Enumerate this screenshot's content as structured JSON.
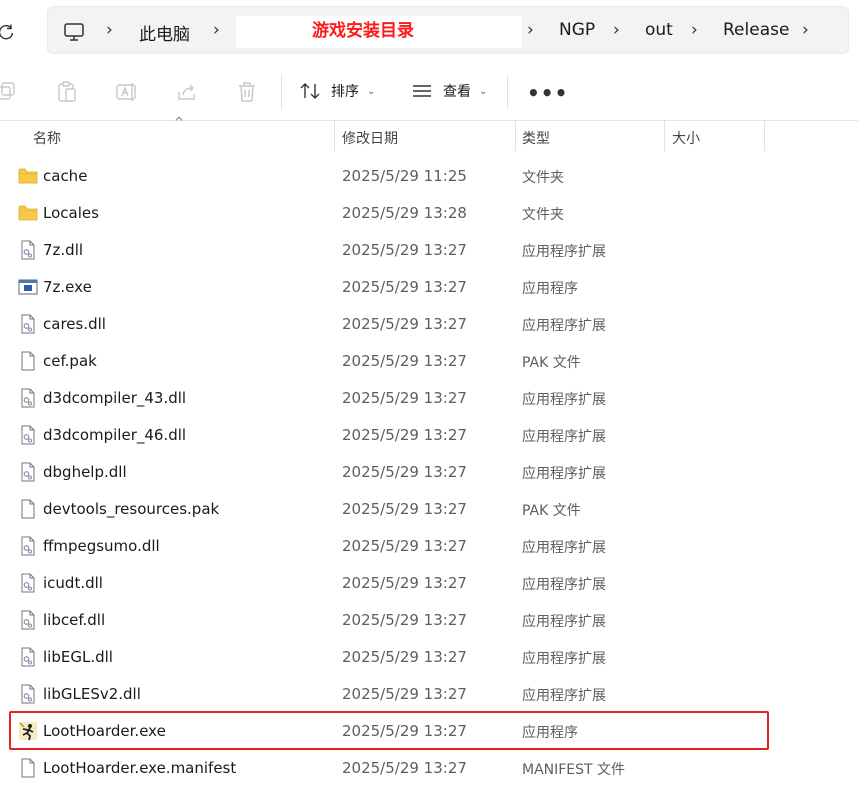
{
  "address_bar": {
    "segments": [
      "此电脑",
      "NGP",
      "out",
      "Release"
    ],
    "annotation": "游戏安装目录"
  },
  "toolbar": {
    "sort_label": "排序",
    "view_label": "查看",
    "more_label": "•••"
  },
  "columns": {
    "name": "名称",
    "modified": "修改日期",
    "type": "类型",
    "size": "大小"
  },
  "files": [
    {
      "name": "cache",
      "date": "2025/5/29 11:25",
      "type": "文件夹",
      "icon": "folder-icon"
    },
    {
      "name": "Locales",
      "date": "2025/5/29 13:28",
      "type": "文件夹",
      "icon": "folder-icon"
    },
    {
      "name": "7z.dll",
      "date": "2025/5/29 13:27",
      "type": "应用程序扩展",
      "icon": "dll-icon"
    },
    {
      "name": "7z.exe",
      "date": "2025/5/29 13:27",
      "type": "应用程序",
      "icon": "exe-icon"
    },
    {
      "name": "cares.dll",
      "date": "2025/5/29 13:27",
      "type": "应用程序扩展",
      "icon": "dll-icon"
    },
    {
      "name": "cef.pak",
      "date": "2025/5/29 13:27",
      "type": "PAK 文件",
      "icon": "file-icon"
    },
    {
      "name": "d3dcompiler_43.dll",
      "date": "2025/5/29 13:27",
      "type": "应用程序扩展",
      "icon": "dll-icon"
    },
    {
      "name": "d3dcompiler_46.dll",
      "date": "2025/5/29 13:27",
      "type": "应用程序扩展",
      "icon": "dll-icon"
    },
    {
      "name": "dbghelp.dll",
      "date": "2025/5/29 13:27",
      "type": "应用程序扩展",
      "icon": "dll-icon"
    },
    {
      "name": "devtools_resources.pak",
      "date": "2025/5/29 13:27",
      "type": "PAK 文件",
      "icon": "file-icon"
    },
    {
      "name": "ffmpegsumo.dll",
      "date": "2025/5/29 13:27",
      "type": "应用程序扩展",
      "icon": "dll-icon"
    },
    {
      "name": "icudt.dll",
      "date": "2025/5/29 13:27",
      "type": "应用程序扩展",
      "icon": "dll-icon"
    },
    {
      "name": "libcef.dll",
      "date": "2025/5/29 13:27",
      "type": "应用程序扩展",
      "icon": "dll-icon"
    },
    {
      "name": "libEGL.dll",
      "date": "2025/5/29 13:27",
      "type": "应用程序扩展",
      "icon": "dll-icon"
    },
    {
      "name": "libGLESv2.dll",
      "date": "2025/5/29 13:27",
      "type": "应用程序扩展",
      "icon": "dll-icon"
    },
    {
      "name": "LootHoarder.exe",
      "date": "2025/5/29 13:27",
      "type": "应用程序",
      "icon": "app-exe-icon"
    },
    {
      "name": "LootHoarder.exe.manifest",
      "date": "2025/5/29 13:27",
      "type": "MANIFEST 文件",
      "icon": "file-icon"
    }
  ],
  "colors": {
    "annotation_red": "#ff1a1a",
    "highlight_border": "#e52222",
    "folder": "#f7c948"
  }
}
